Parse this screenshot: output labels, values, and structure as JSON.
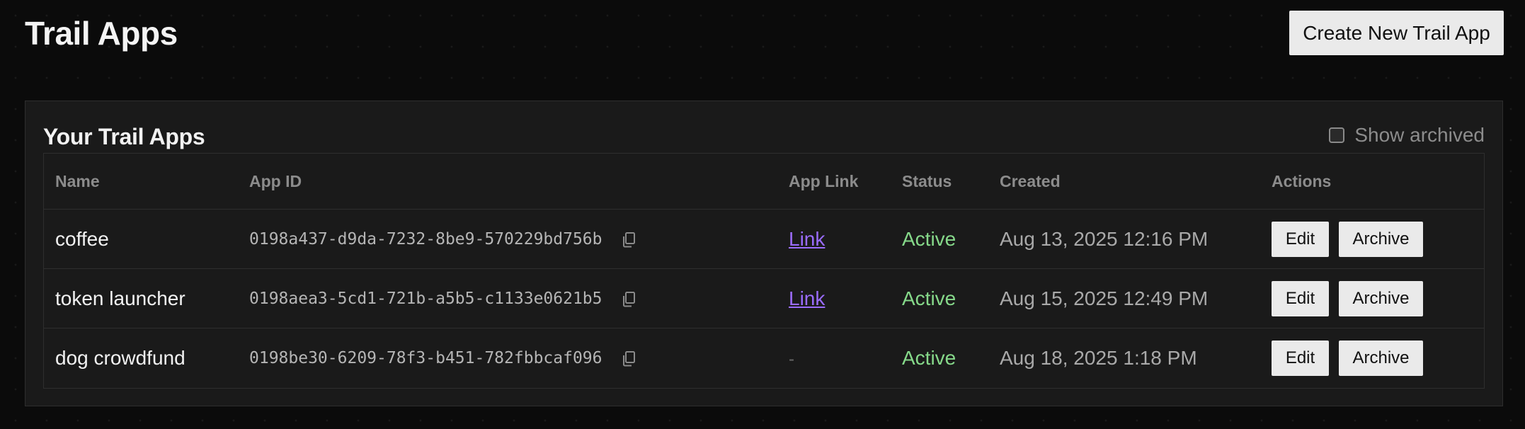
{
  "header": {
    "title": "Trail Apps",
    "create_button_label": "Create New Trail App"
  },
  "panel": {
    "title": "Your Trail Apps",
    "show_archived_label": "Show archived",
    "show_archived_checked": false
  },
  "table": {
    "columns": {
      "name": "Name",
      "app_id": "App ID",
      "app_link": "App Link",
      "status": "Status",
      "created": "Created",
      "actions": "Actions"
    },
    "rows": [
      {
        "name": "coffee",
        "app_id": "0198a437-d9da-7232-8be9-570229bd756b",
        "app_link": "Link",
        "status": "Active",
        "created": "Aug 13, 2025 12:16 PM",
        "edit_label": "Edit",
        "archive_label": "Archive"
      },
      {
        "name": "token launcher",
        "app_id": "0198aea3-5cd1-721b-a5b5-c1133e0621b5",
        "app_link": "Link",
        "status": "Active",
        "created": "Aug 15, 2025 12:49 PM",
        "edit_label": "Edit",
        "archive_label": "Archive"
      },
      {
        "name": "dog crowdfund",
        "app_id": "0198be30-6209-78f3-b451-782fbbcaf096",
        "app_link": "-",
        "status": "Active",
        "created": "Aug 18, 2025 1:18 PM",
        "edit_label": "Edit",
        "archive_label": "Archive"
      }
    ]
  },
  "icons": {
    "copy": "copy-icon"
  },
  "colors": {
    "background": "#0b0b0b",
    "panel": "#1a1a1a",
    "link": "#9b6cff",
    "status_active": "#86d98a",
    "button_bg": "#eaeaea"
  }
}
